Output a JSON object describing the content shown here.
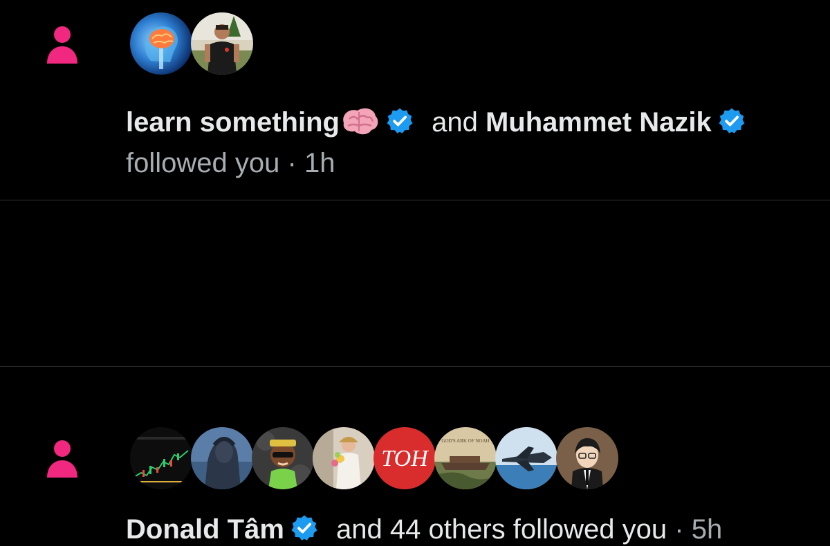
{
  "notifications": [
    {
      "icon": "person-icon",
      "avatars": [
        "brain-avatar",
        "man-outdoor-avatar"
      ],
      "user1": "learn something",
      "connector": "and",
      "user2": "Muhammet Nazik",
      "action": "followed you",
      "separator": "·",
      "time": "1h"
    },
    {
      "icon": "person-icon",
      "avatars": [
        "chart-avatar",
        "statue-avatar",
        "cartoon-avatar",
        "flowers-avatar",
        "toh-avatar",
        "ark-avatar",
        "jet-avatar",
        "anime-avatar"
      ],
      "user1": "Donald Tâm",
      "rest": "and 44 others followed you",
      "separator": "·",
      "time": "5h",
      "toh_text": "TOH",
      "ark_text": "GOD'S ARK OF NOAH"
    }
  ],
  "colors": {
    "background": "#000000",
    "text": "#e7e9ea",
    "muted": "#a8adb2",
    "accent_pink": "#f0287f",
    "verified_blue": "#1d9bf0",
    "divider": "#2f3336"
  }
}
